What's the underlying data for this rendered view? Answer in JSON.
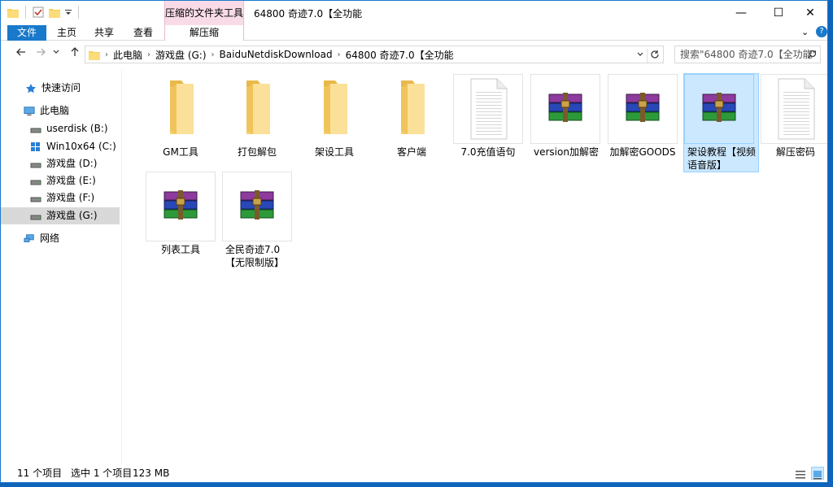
{
  "window": {
    "title": "64800 奇迹7.0【全功能",
    "context_tab": "压缩的文件夹工具",
    "minimize": "—",
    "maximize": "☐",
    "close": "✕"
  },
  "ribbon": {
    "tabs": [
      "文件",
      "主页",
      "共享",
      "查看"
    ],
    "context_subtab": "解压缩",
    "expand": "⌄",
    "help": "?"
  },
  "address": {
    "crumbs": [
      "此电脑",
      "游戏盘 (G:)",
      "BaiduNetdiskDownload",
      "64800 奇迹7.0【全功能"
    ],
    "search_placeholder": "搜索\"64800 奇迹7.0【全功能\""
  },
  "nav": {
    "quick_access": "快速访问",
    "this_pc": "此电脑",
    "drives": [
      "userdisk (B:)",
      "Win10x64 (C:)",
      "游戏盘 (D:)",
      "游戏盘 (E:)",
      "游戏盘 (F:)",
      "游戏盘 (G:)"
    ],
    "network": "网络"
  },
  "files": [
    {
      "name": "GM工具",
      "type": "folder"
    },
    {
      "name": "打包解包",
      "type": "folder"
    },
    {
      "name": "架设工具",
      "type": "folder"
    },
    {
      "name": "客户端",
      "type": "folder"
    },
    {
      "name": "7.0充值语句",
      "type": "text"
    },
    {
      "name": "version加解密",
      "type": "rar"
    },
    {
      "name": "加解密GOODS",
      "type": "rar"
    },
    {
      "name": "架设教程【视频语音版】",
      "type": "rar"
    },
    {
      "name": "解压密码",
      "type": "text"
    },
    {
      "name": "列表工具",
      "type": "rar"
    },
    {
      "name": "全民奇迹7.0【无限制版】",
      "type": "rar"
    }
  ],
  "status": {
    "count": "11 个项目",
    "selected": "选中 1 个项目",
    "size": "123 MB"
  },
  "colors": {
    "accent": "#1979ca",
    "context": "#f9dbe8",
    "selection": "#cce8ff"
  }
}
